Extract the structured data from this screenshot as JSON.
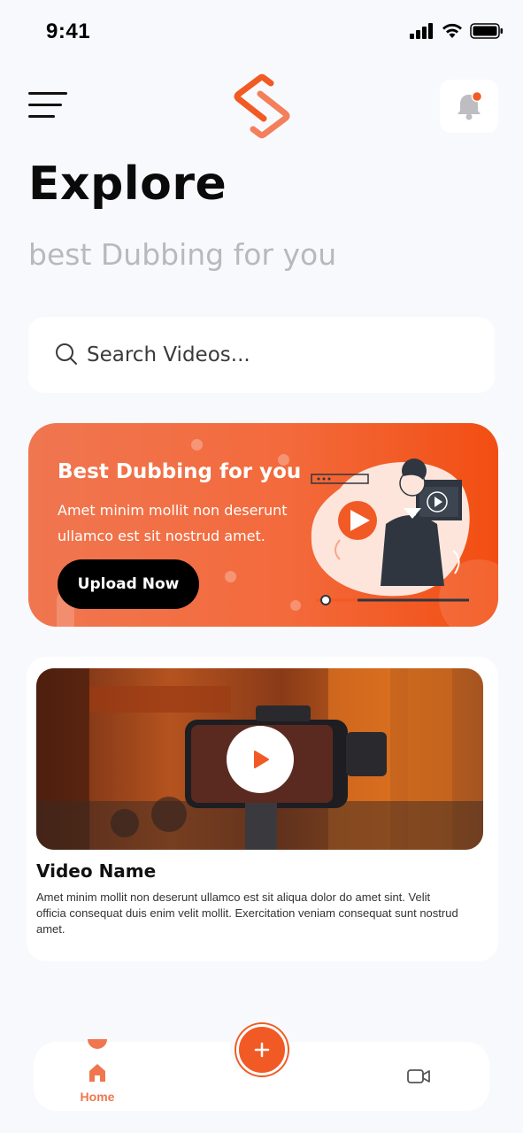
{
  "status_bar": {
    "time": "9:41"
  },
  "header": {
    "menu_icon": "hamburger-menu-icon",
    "logo_icon": "brand-s-logo",
    "notification_icon": "bell-icon",
    "accent_color": "#f15a24"
  },
  "page": {
    "title": "Explore",
    "subtitle": "best Dubbing for you"
  },
  "search": {
    "placeholder": "Search Videos...",
    "value": ""
  },
  "promo": {
    "title": "Best Dubbing for you",
    "text": "Amet minim mollit non deserunt ullamco est sit nostrud amet.",
    "button_label": "Upload Now"
  },
  "video_card": {
    "name": "Video Name",
    "description": "Amet minim mollit non deserunt ullamco est sit aliqua dolor do amet sint. Velit officia consequat duis enim velit mollit. Exercitation veniam consequat sunt nostrud amet."
  },
  "bottom_nav": {
    "home_label": "Home",
    "add_icon": "plus-icon",
    "video_icon": "video-camera-icon"
  }
}
